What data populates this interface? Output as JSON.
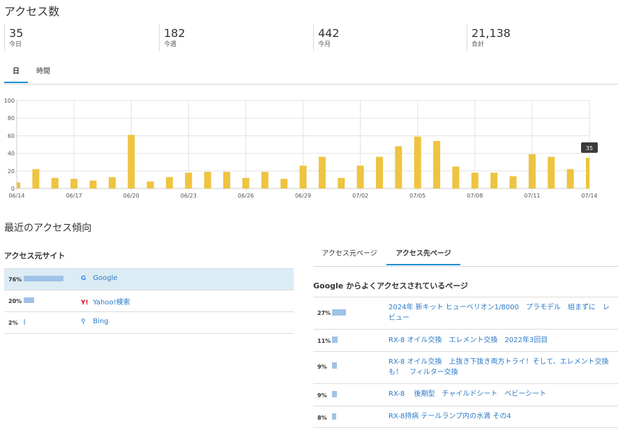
{
  "page_title": "アクセス数",
  "stats": [
    {
      "value": "35",
      "label": "今日"
    },
    {
      "value": "182",
      "label": "今週"
    },
    {
      "value": "442",
      "label": "今月"
    },
    {
      "value": "21,138",
      "label": "合計"
    }
  ],
  "top_tabs": [
    "日",
    "時間"
  ],
  "chart_data": {
    "type": "bar",
    "x_tick_labels": [
      "06/14",
      "06/17",
      "06/20",
      "06/23",
      "06/26",
      "06/29",
      "07/02",
      "07/05",
      "07/08",
      "07/11",
      "07/14"
    ],
    "categories": [
      "06/14",
      "06/15",
      "06/16",
      "06/17",
      "06/18",
      "06/19",
      "06/20",
      "06/21",
      "06/22",
      "06/23",
      "06/24",
      "06/25",
      "06/26",
      "06/27",
      "06/28",
      "06/29",
      "06/30",
      "07/01",
      "07/02",
      "07/03",
      "07/04",
      "07/05",
      "07/06",
      "07/07",
      "07/08",
      "07/09",
      "07/10",
      "07/11",
      "07/12",
      "07/13",
      "07/14"
    ],
    "values": [
      7,
      22,
      12,
      11,
      9,
      13,
      61,
      8,
      13,
      18,
      19,
      19,
      12,
      19,
      11,
      26,
      36,
      12,
      26,
      36,
      48,
      59,
      54,
      25,
      18,
      18,
      14,
      39,
      36,
      22,
      35
    ],
    "ylim": [
      0,
      100
    ],
    "yticks": [
      0,
      20,
      40,
      60,
      80,
      100
    ],
    "bar_color": "#eec440",
    "grid": true,
    "tooltip": "35"
  },
  "trend_title": "最近のアクセス傾向",
  "referrers_title": "アクセス元サイト",
  "referrers": [
    {
      "pct": "76%",
      "value": 76,
      "icon": "google-icon",
      "icon_glyph": "G",
      "name": "Google"
    },
    {
      "pct": "20%",
      "value": 20,
      "icon": "yahoo-icon",
      "icon_glyph": "Y!",
      "name": "Yahoo!検索"
    },
    {
      "pct": "2%",
      "value": 2,
      "icon": "bing-search-icon",
      "icon_glyph": "⚲",
      "name": "Bing"
    }
  ],
  "right_tabs": [
    "アクセス元ページ",
    "アクセス先ページ"
  ],
  "pages_title": "Google からよくアクセスされているページ",
  "pages": [
    {
      "pct": "27%",
      "value": 27,
      "title": "2024年 新キット ヒューベリオン1/8000　プラモデル　組まずに　レビュー"
    },
    {
      "pct": "11%",
      "value": 11,
      "title": "RX-8 オイル交換　エレメント交換　2022年3回目"
    },
    {
      "pct": "9%",
      "value": 9,
      "title": "RX-8 オイル交換　上抜き下抜き両方トライ！そして、エレメント交換も！　フィルター交換"
    },
    {
      "pct": "9%",
      "value": 9,
      "title": "RX-8　 後期型　チャイルドシート　ベビーシート"
    },
    {
      "pct": "8%",
      "value": 8,
      "title": "RX-8持病 テールランプ内の水滴 その4"
    }
  ]
}
